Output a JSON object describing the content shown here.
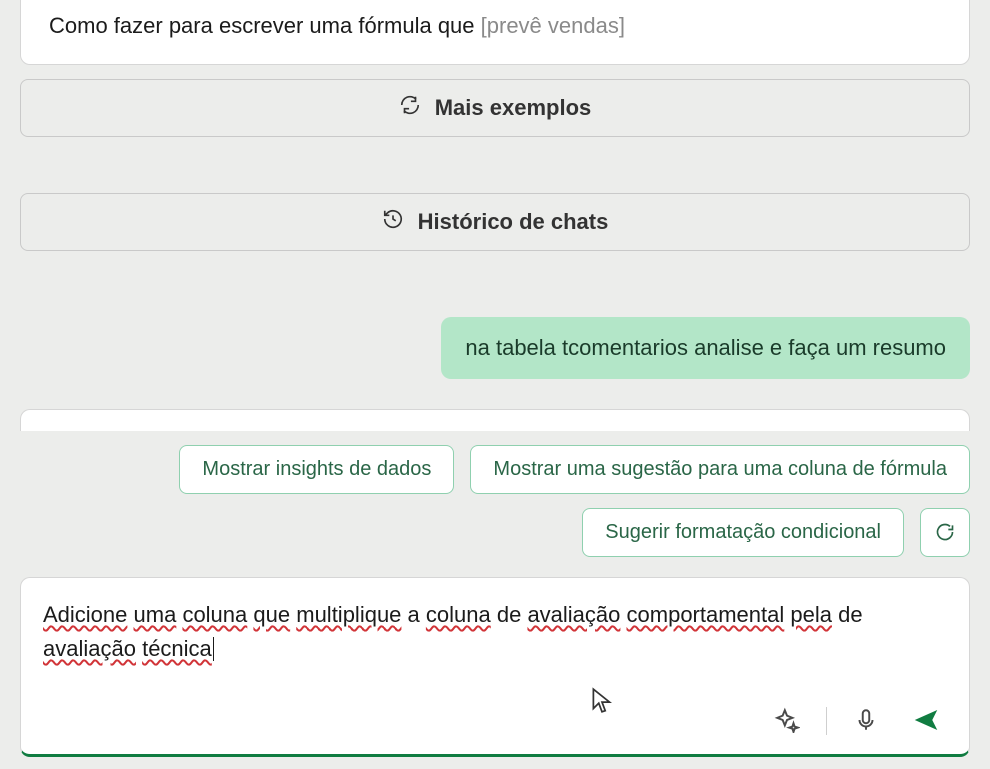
{
  "example": {
    "prefix": "Como fazer para escrever uma fórmula que ",
    "placeholder": "[prevê vendas]"
  },
  "buttons": {
    "more_examples": "Mais exemplos",
    "chat_history": "Histórico de chats"
  },
  "user_message": "na tabela tcomentarios analise e faça um resumo",
  "chips": {
    "insights": "Mostrar insights de dados",
    "formula_col": "Mostrar uma sugestão para uma coluna de fórmula",
    "cond_format": "Sugerir formatação condicional"
  },
  "input": {
    "w1": "Adicione",
    "w2": "uma",
    "w3": "coluna",
    "w4": "que",
    "w5": "multiplique",
    "mid": " a ",
    "w6": "coluna",
    "mid2": " de ",
    "w7": "avaliação",
    "w8": "comportamental",
    "w9": "pela",
    "mid3": "de ",
    "w10": "avaliação",
    "w11": "técnica"
  }
}
